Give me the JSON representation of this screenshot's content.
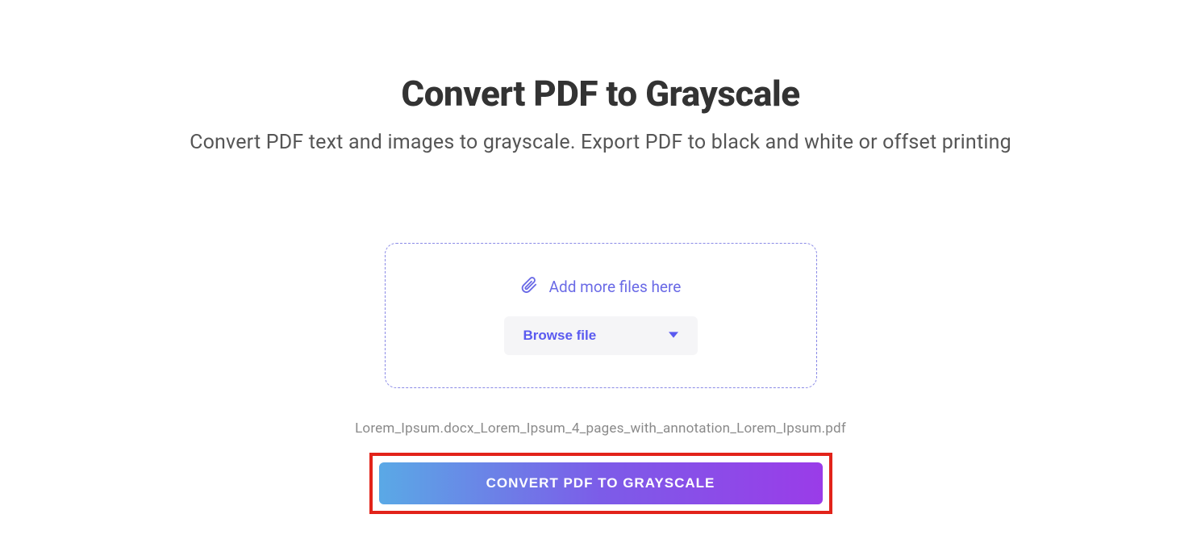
{
  "header": {
    "title": "Convert PDF to Grayscale",
    "subtitle": "Convert PDF text and images to grayscale. Export PDF to black and white or offset printing"
  },
  "dropzone": {
    "add_more_label": "Add more files here",
    "browse_label": "Browse file"
  },
  "file": {
    "name": "Lorem_Ipsum.docx_Lorem_Ipsum_4_pages_with_annotation_Lorem_Ipsum.pdf"
  },
  "actions": {
    "convert_label": "CONVERT PDF TO GRAYSCALE"
  }
}
